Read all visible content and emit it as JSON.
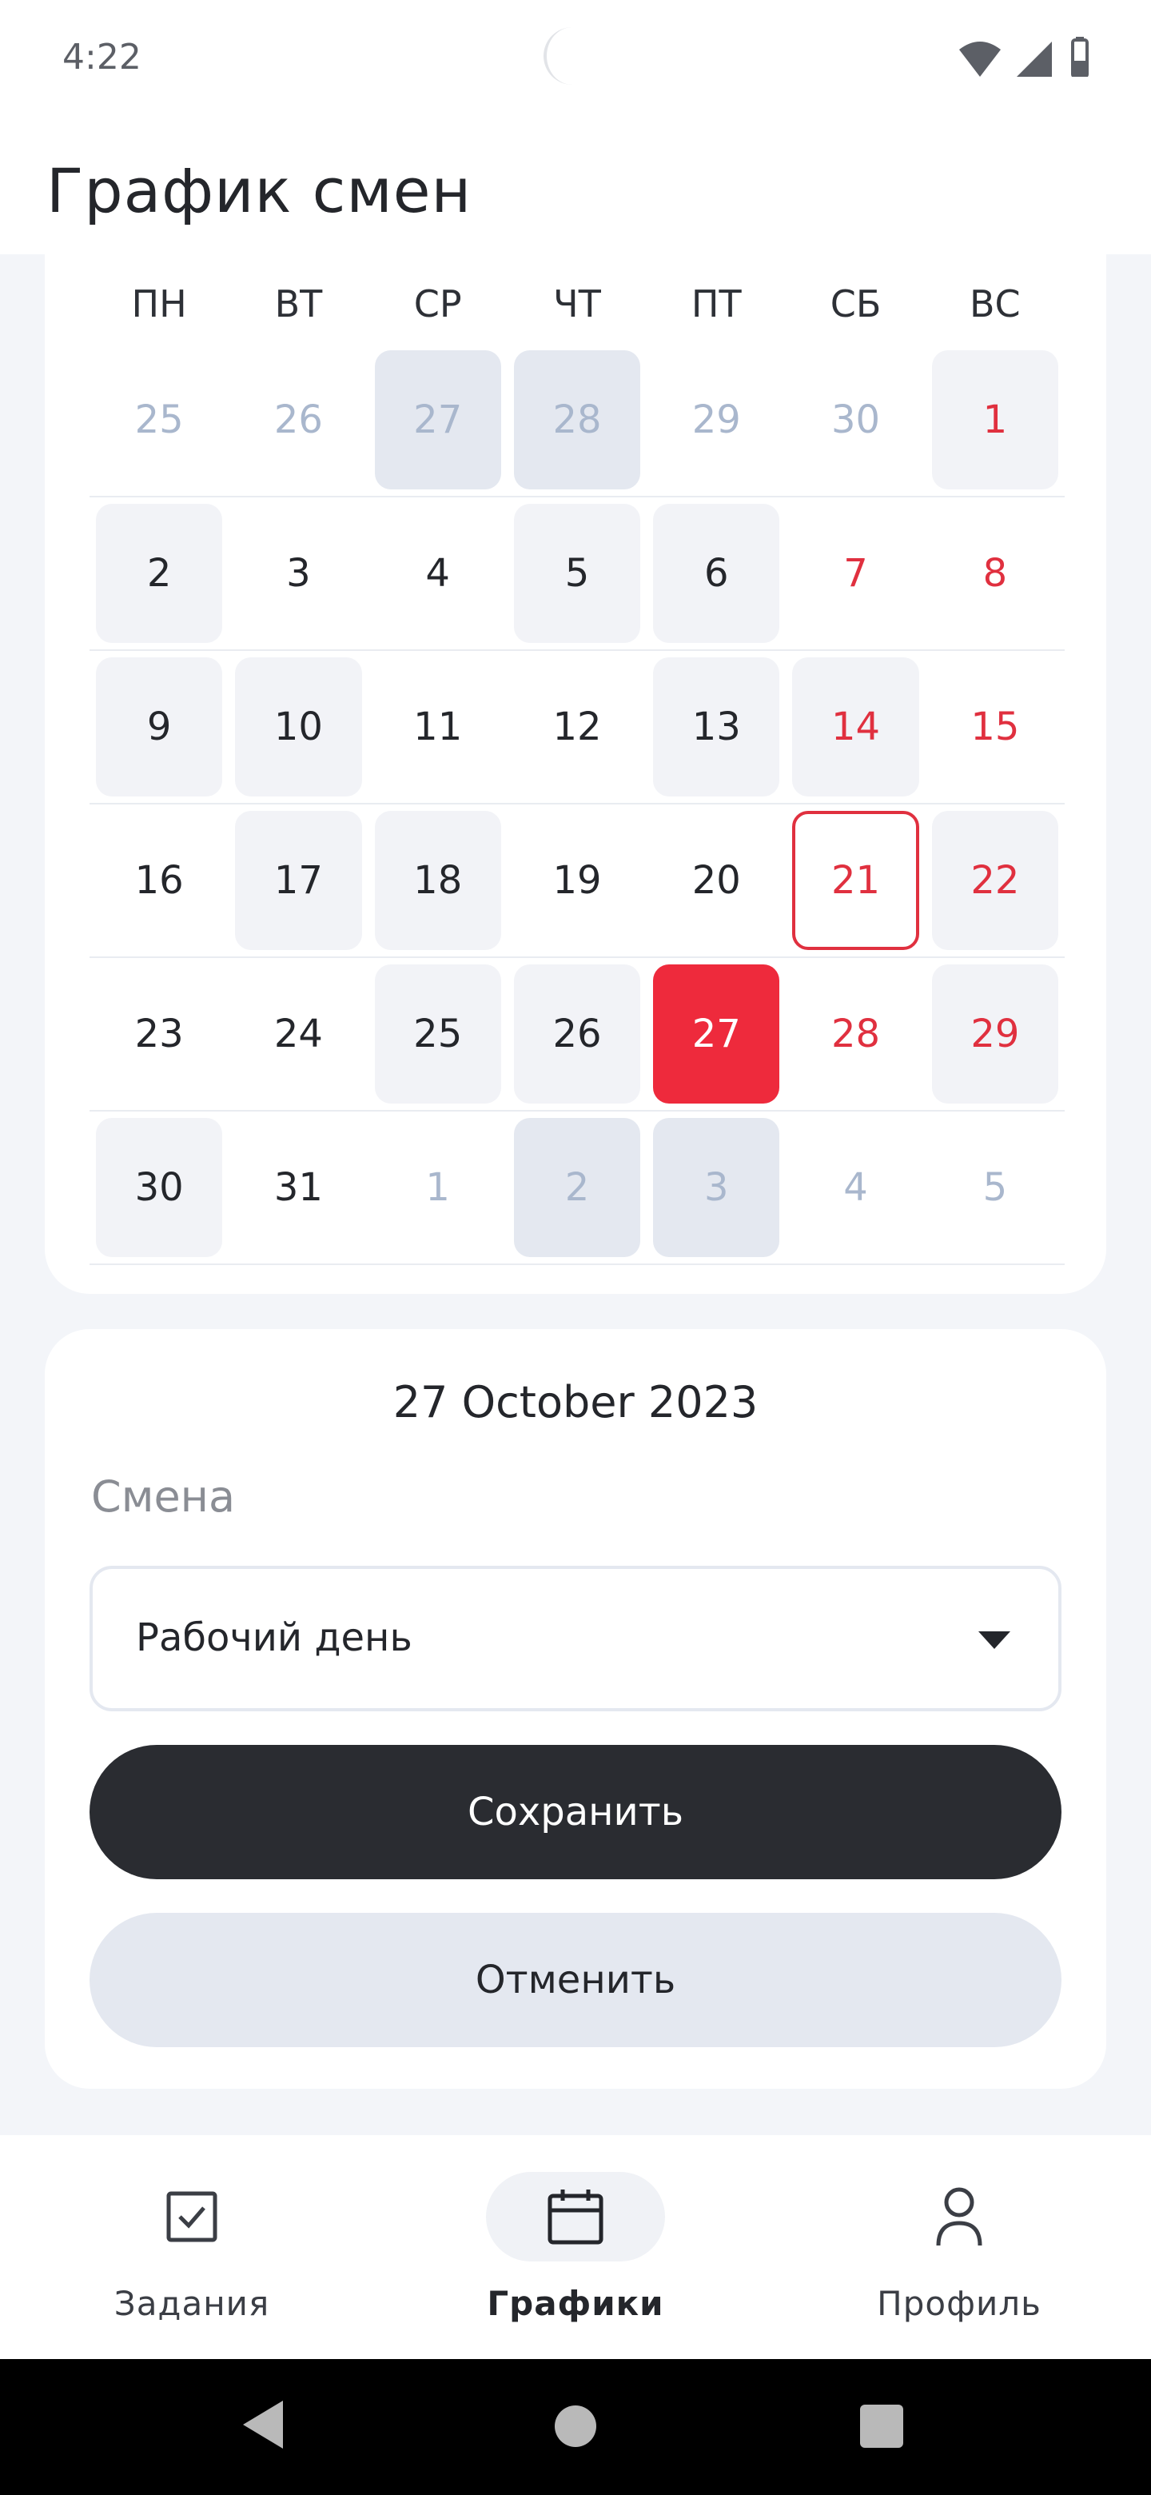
{
  "status_bar": {
    "time": "4:22"
  },
  "header": {
    "title": "График смен"
  },
  "calendar": {
    "weekdays": [
      "ПН",
      "ВТ",
      "СР",
      "ЧТ",
      "ПТ",
      "СБ",
      "ВС"
    ],
    "weeks": [
      [
        {
          "day": "25",
          "state": "outside"
        },
        {
          "day": "26",
          "state": "outside"
        },
        {
          "day": "27",
          "state": "outside-marked"
        },
        {
          "day": "28",
          "state": "outside-marked"
        },
        {
          "day": "29",
          "state": "outside"
        },
        {
          "day": "30",
          "state": "outside"
        },
        {
          "day": "1",
          "state": "weekend-marked"
        }
      ],
      [
        {
          "day": "2",
          "state": "marked"
        },
        {
          "day": "3",
          "state": "normal"
        },
        {
          "day": "4",
          "state": "normal"
        },
        {
          "day": "5",
          "state": "marked"
        },
        {
          "day": "6",
          "state": "marked"
        },
        {
          "day": "7",
          "state": "weekend"
        },
        {
          "day": "8",
          "state": "weekend"
        }
      ],
      [
        {
          "day": "9",
          "state": "marked"
        },
        {
          "day": "10",
          "state": "marked"
        },
        {
          "day": "11",
          "state": "normal"
        },
        {
          "day": "12",
          "state": "normal"
        },
        {
          "day": "13",
          "state": "marked"
        },
        {
          "day": "14",
          "state": "weekend-marked"
        },
        {
          "day": "15",
          "state": "weekend"
        }
      ],
      [
        {
          "day": "16",
          "state": "normal"
        },
        {
          "day": "17",
          "state": "marked"
        },
        {
          "day": "18",
          "state": "marked"
        },
        {
          "day": "19",
          "state": "normal"
        },
        {
          "day": "20",
          "state": "normal"
        },
        {
          "day": "21",
          "state": "today"
        },
        {
          "day": "22",
          "state": "weekend-marked"
        }
      ],
      [
        {
          "day": "23",
          "state": "normal"
        },
        {
          "day": "24",
          "state": "normal"
        },
        {
          "day": "25",
          "state": "marked"
        },
        {
          "day": "26",
          "state": "marked"
        },
        {
          "day": "27",
          "state": "selected"
        },
        {
          "day": "28",
          "state": "weekend"
        },
        {
          "day": "29",
          "state": "weekend-marked"
        }
      ],
      [
        {
          "day": "30",
          "state": "marked"
        },
        {
          "day": "31",
          "state": "normal"
        },
        {
          "day": "1",
          "state": "outside"
        },
        {
          "day": "2",
          "state": "outside-marked"
        },
        {
          "day": "3",
          "state": "outside-marked"
        },
        {
          "day": "4",
          "state": "outside"
        },
        {
          "day": "5",
          "state": "outside"
        }
      ]
    ]
  },
  "editor": {
    "selected_date": "27 October 2023",
    "shift_label": "Смена",
    "shift_value": "Рабочий день",
    "save_label": "Сохранить",
    "cancel_label": "Отменить"
  },
  "bottom_nav": {
    "items": [
      {
        "label": "Задания",
        "icon": "checkbox-icon",
        "active": false
      },
      {
        "label": "Графики",
        "icon": "calendar-icon",
        "active": true
      },
      {
        "label": "Профиль",
        "icon": "profile-icon",
        "active": false
      }
    ]
  },
  "colors": {
    "accent": "#ee2a3c",
    "weekend_text": "#e0303f",
    "outside_text": "#a9b7cd",
    "dark_button": "#2a2c31"
  }
}
